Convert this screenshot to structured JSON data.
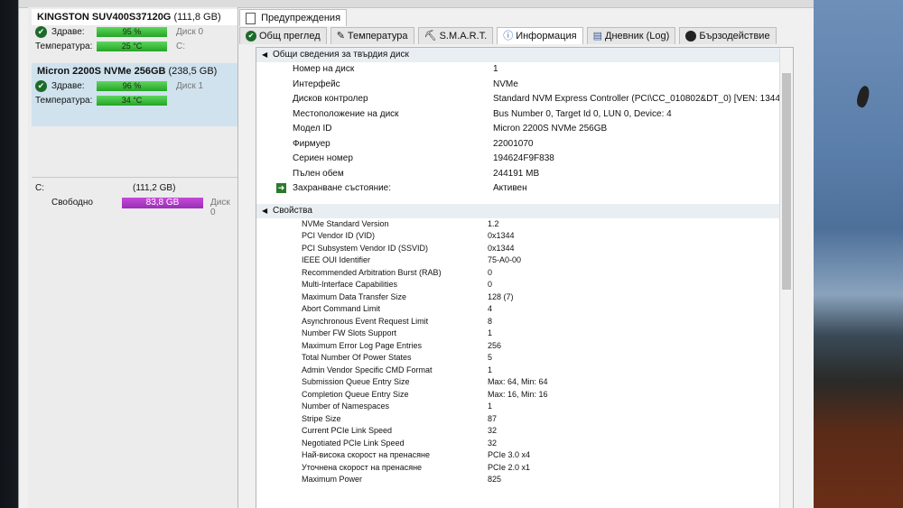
{
  "disks": [
    {
      "name": "KINGSTON SUV400S37120G",
      "size": "(111,8 GB)",
      "health_label": "Здраве:",
      "health_value": "95 %",
      "health_drive": "Диск 0",
      "temp_label": "Температура:",
      "temp_value": "25 °C",
      "temp_drive": "C:"
    },
    {
      "name": "Micron 2200S NVMe 256GB",
      "size": "(238,5 GB)",
      "health_label": "Здраве:",
      "health_value": "96 %",
      "health_drive": "Диск 1",
      "temp_label": "Температура:",
      "temp_value": "34 °C",
      "temp_drive": ""
    }
  ],
  "volume": {
    "letter": "C:",
    "size": "(111,2 GB)",
    "free_label": "Свободно",
    "free_value": "83,8 GB",
    "disk": "Диск 0"
  },
  "tabs_top": [
    "Предупреждения"
  ],
  "tabs": [
    "Общ преглед",
    "Температура",
    "S.M.A.R.T.",
    "Информация",
    "Дневник (Log)",
    "Бързодействие"
  ],
  "general": {
    "title": "Общи сведения за твърдия диск",
    "rows": [
      [
        "Номер на диск",
        "1"
      ],
      [
        "Интерфейс",
        "NVMe"
      ],
      [
        "Дисков контролер",
        "Standard NVM Express Controller (PCI\\CC_010802&DT_0) [VEN: 1344,..."
      ],
      [
        "Местоположение на диск",
        "Bus Number 0, Target Id 0, LUN 0, Device: 4"
      ],
      [
        "Модел ID",
        "Micron 2200S NVMe 256GB"
      ],
      [
        "Фирмуер",
        "22001070"
      ],
      [
        "Сериен номер",
        "194624F9F838"
      ],
      [
        "Пълен обем",
        "244191 MB"
      ],
      [
        "Захранване състояние:",
        "Активен"
      ]
    ]
  },
  "props": {
    "title": "Свойства",
    "rows": [
      [
        "NVMe Standard Version",
        "1.2"
      ],
      [
        "PCI Vendor ID (VID)",
        "0x1344"
      ],
      [
        "PCI Subsystem Vendor ID (SSVID)",
        "0x1344"
      ],
      [
        "IEEE OUI Identifier",
        "75-A0-00"
      ],
      [
        "Recommended Arbitration Burst (RAB)",
        "0"
      ],
      [
        "Multi-Interface Capabilities",
        "0"
      ],
      [
        "Maximum Data Transfer Size",
        "128 (7)"
      ],
      [
        "Abort Command Limit",
        "4"
      ],
      [
        "Asynchronous Event Request Limit",
        "8"
      ],
      [
        "Number FW Slots Support",
        "1"
      ],
      [
        "Maximum Error Log Page Entries",
        "256"
      ],
      [
        "Total Number Of Power States",
        "5"
      ],
      [
        "Admin Vendor Specific CMD Format",
        "1"
      ],
      [
        "Submission Queue Entry Size",
        "Max: 64, Min: 64"
      ],
      [
        "Completion Queue Entry Size",
        "Max: 16, Min: 16"
      ],
      [
        "Number of Namespaces",
        "1"
      ],
      [
        "Stripe Size",
        "87"
      ],
      [
        "Current PCIe Link Speed",
        "32"
      ],
      [
        "Negotiated PCIe Link Speed",
        "32"
      ],
      [
        "Най-висока скорост на пренасяне",
        "PCIe 3.0 x4"
      ],
      [
        "Уточнена скорост на пренасяне",
        "PCIe 2.0 x1"
      ],
      [
        "Maximum Power",
        "825"
      ]
    ]
  },
  "colors": {
    "health_bar": "#24a524",
    "free_bar": "#9a2eb6",
    "selected_disk": "#cfe2ee"
  }
}
